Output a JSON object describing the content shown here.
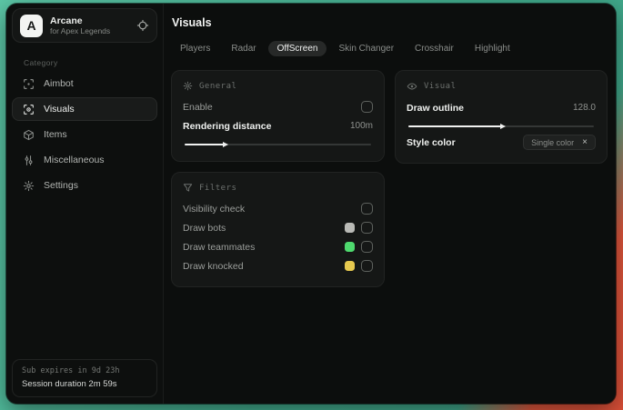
{
  "app": {
    "logo_letter": "A",
    "name": "Arcane",
    "subtitle": "for Apex Legends"
  },
  "sidebar": {
    "category_label": "Category",
    "items": [
      {
        "label": "Aimbot"
      },
      {
        "label": "Visuals",
        "active": true
      },
      {
        "label": "Items"
      },
      {
        "label": "Miscellaneous"
      },
      {
        "label": "Settings"
      }
    ],
    "footer": {
      "sub_expiry": "Sub expires in 9d 23h",
      "session_duration": "Session duration 2m 59s"
    }
  },
  "header": {
    "title": "Visuals"
  },
  "tabs": {
    "items": [
      {
        "label": "Players"
      },
      {
        "label": "Radar"
      },
      {
        "label": "OffScreen",
        "active": true
      },
      {
        "label": "Skin Changer"
      },
      {
        "label": "Crosshair"
      },
      {
        "label": "Highlight"
      }
    ]
  },
  "panels": {
    "general": {
      "title": "General",
      "enable_label": "Enable",
      "rendering_distance_label": "Rendering distance",
      "rendering_distance_value": "100m",
      "rendering_distance_fill_percent": 21
    },
    "visual": {
      "title": "Visual",
      "draw_outline_label": "Draw outline",
      "draw_outline_value": "128.0",
      "draw_outline_fill_percent": 50,
      "style_color_label": "Style color",
      "style_color_value": "Single color",
      "style_color_clear": "×"
    },
    "filters": {
      "title": "Filters",
      "rows": [
        {
          "label": "Visibility check",
          "swatch": null
        },
        {
          "label": "Draw bots",
          "swatch": "#b9bab6"
        },
        {
          "label": "Draw teammates",
          "swatch": "#4ed96e"
        },
        {
          "label": "Draw knocked",
          "swatch": "#e6c94f"
        }
      ]
    }
  },
  "colors": {
    "desktop_teal": "#42ac8d",
    "desktop_orange": "#e0563c",
    "swatch_gray": "#b9bab6",
    "swatch_green": "#4ed96e",
    "swatch_yellow": "#e6c94f",
    "slider_fill": "#f0f1f0"
  }
}
